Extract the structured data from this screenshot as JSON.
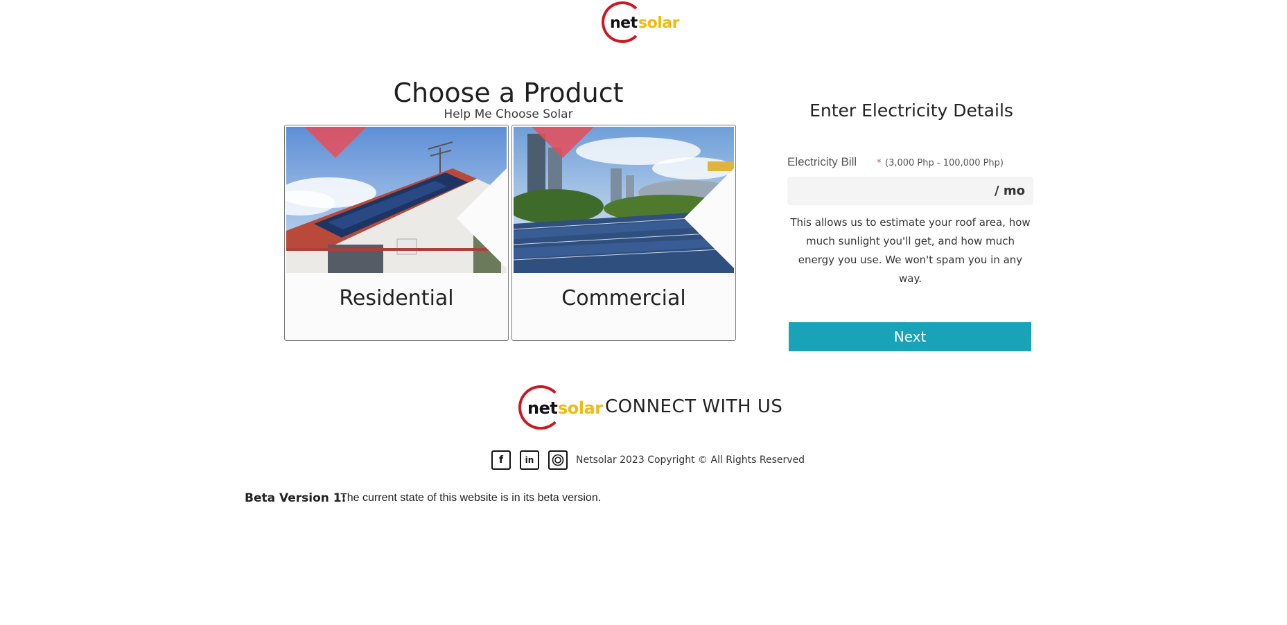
{
  "header": {
    "logo": {
      "part1": "net",
      "part2": "solar"
    }
  },
  "products": {
    "title": "Choose a Product",
    "subtitle": "Help Me Choose Solar",
    "items": [
      {
        "label": "Residential"
      },
      {
        "label": "Commercial"
      }
    ]
  },
  "electricity": {
    "title": "Enter Electricity Details",
    "bill_label": "Electricity Bill",
    "required_marker": "*",
    "range": "(3,000 Php - 100,000 Php)",
    "input_value": "",
    "unit": "/ mo",
    "help": "This allows us to estimate your roof area, how much sunlight you'll get, and how much energy you use. We won't spam you in any way.",
    "next_label": "Next"
  },
  "footer": {
    "logo": {
      "part1": "net",
      "part2": "solar"
    },
    "connect": "CONNECT WITH US",
    "social": [
      {
        "icon": "facebook-icon",
        "glyph": "f"
      },
      {
        "icon": "linkedin-icon",
        "glyph": "in"
      },
      {
        "icon": "instagram-icon",
        "glyph": ""
      }
    ],
    "copyright": "Netsolar 2023 Copyright © All Rights Reserved",
    "beta_label": "Beta Version 1:",
    "beta_text": "The current state of this website is in its beta version."
  },
  "colors": {
    "accent": "#19a3b8",
    "logo_red": "#d0171f",
    "logo_yellow": "#f2b90f",
    "ribbon": "#e84c58"
  }
}
